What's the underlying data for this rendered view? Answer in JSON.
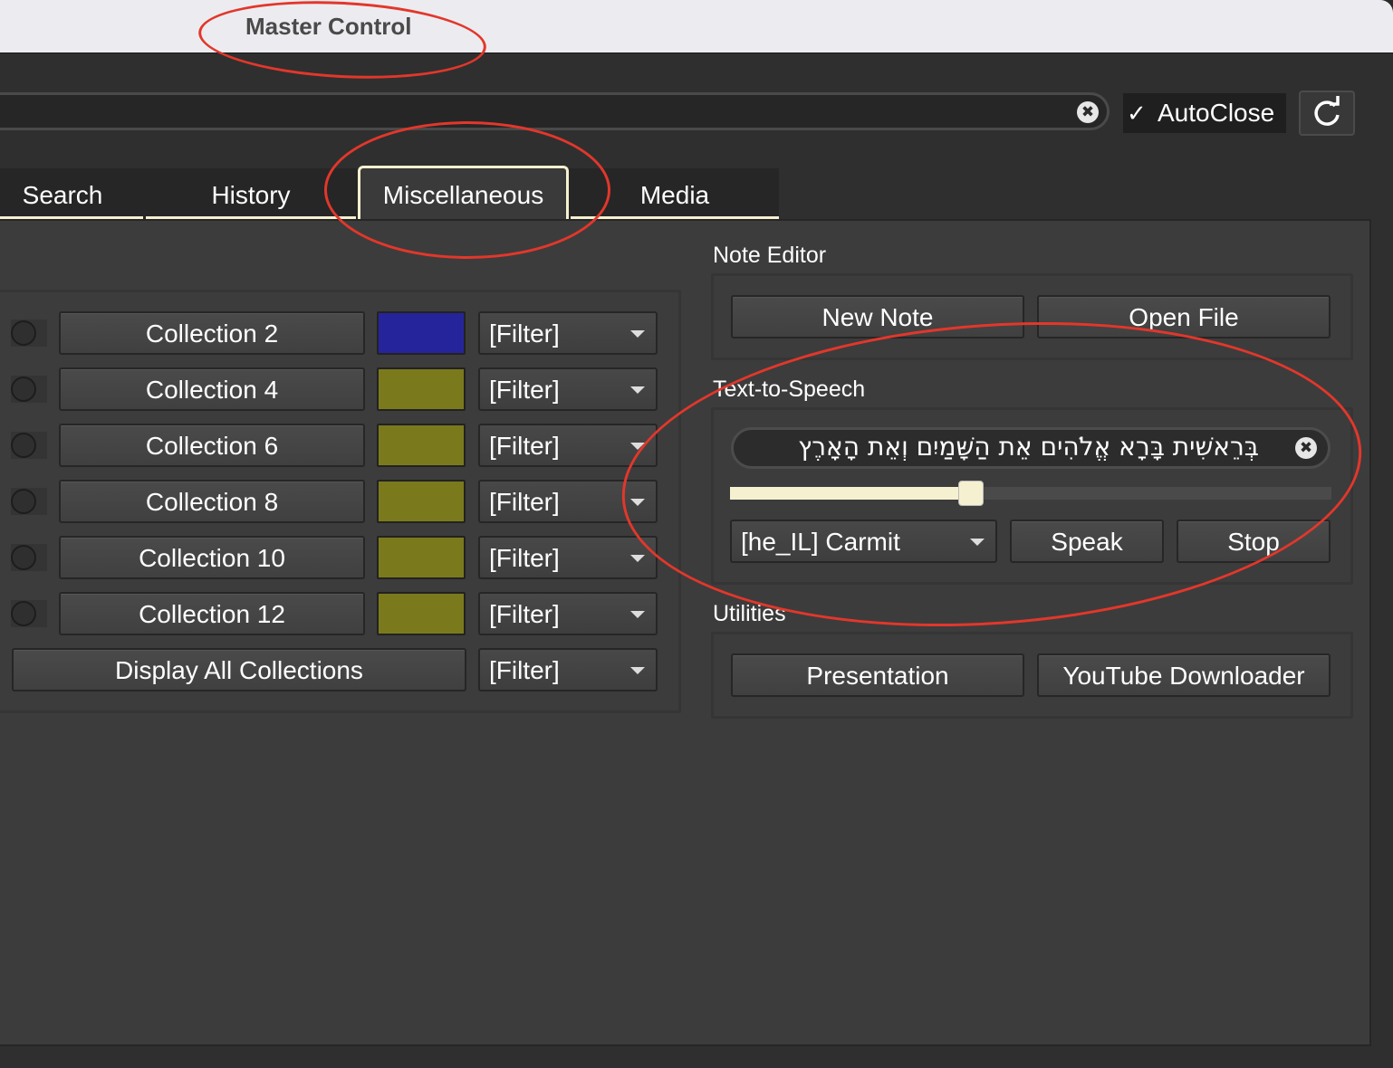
{
  "window": {
    "title": "Master Control"
  },
  "toolbar": {
    "autoclose_label": "AutoClose",
    "autoclose_checked": true,
    "autoclose_check": "✓"
  },
  "tabs": [
    {
      "label": "Search"
    },
    {
      "label": "History"
    },
    {
      "label": "Miscellaneous",
      "active": true
    },
    {
      "label": "Media"
    }
  ],
  "collections": [
    {
      "label": "Collection 2",
      "color": "#26249a",
      "filter": "[Filter]"
    },
    {
      "label": "Collection 4",
      "color": "#7a7a1c",
      "filter": "[Filter]"
    },
    {
      "label": "Collection 6",
      "color": "#7a7a1c",
      "filter": "[Filter]"
    },
    {
      "label": "Collection 8",
      "color": "#7a7a1c",
      "filter": "[Filter]"
    },
    {
      "label": "Collection 10",
      "color": "#7a7a1c",
      "filter": "[Filter]"
    },
    {
      "label": "Collection 12",
      "color": "#7a7a1c",
      "filter": "[Filter]"
    }
  ],
  "display_all": {
    "label": "Display All Collections",
    "filter": "[Filter]"
  },
  "note_editor": {
    "heading": "Note Editor",
    "new_note": "New Note",
    "open_file": "Open File"
  },
  "tts": {
    "heading": "Text-to-Speech",
    "text": "בְּרֵאשִׁית בָּרָא אֱלֹהִים אֵת הַשָּׁמַיִם וְאֵת הָאָרֶץ",
    "rate": 0.4,
    "voice": "[he_IL] Carmit",
    "speak": "Speak",
    "stop": "Stop"
  },
  "utilities": {
    "heading": "Utilities",
    "presentation": "Presentation",
    "youtube": "YouTube Downloader"
  },
  "icons": {
    "clear": "✖",
    "refresh": "refresh-icon"
  },
  "colors": {
    "accent": "#f5f0d0",
    "annotation": "#e2372b"
  }
}
